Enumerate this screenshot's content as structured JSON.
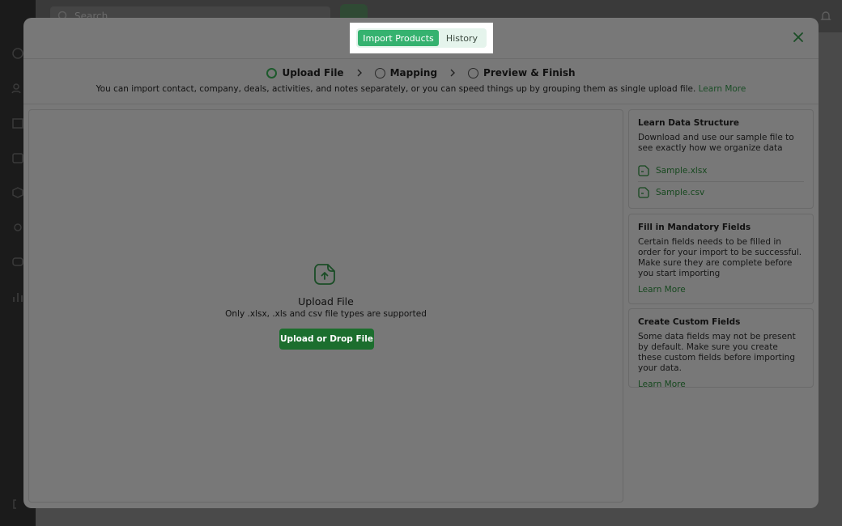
{
  "background": {
    "search_placeholder": "Search"
  },
  "modal": {
    "tabs": [
      {
        "label": "Import Products",
        "active": true
      },
      {
        "label": "History",
        "active": false
      }
    ],
    "steps": [
      {
        "label": "Upload File",
        "current": true
      },
      {
        "label": "Mapping",
        "current": false
      },
      {
        "label": "Preview & Finish",
        "current": false
      }
    ],
    "subtitle": "You can import contact, company, deals, activities, and notes separately, or you can speed things up by grouping them as single upload file.",
    "subtitle_link": "Learn More",
    "upload": {
      "title": "Upload File",
      "note": "Only .xlsx, .xls and csv file types are supported",
      "button": "Upload or Drop File"
    },
    "cards": {
      "learn": {
        "title": "Learn Data Structure",
        "text": "Download and use our sample file to see exactly how we organize  data",
        "files": [
          "Sample.xlsx",
          "Sample.csv"
        ]
      },
      "mandatory": {
        "title": "Fill in Mandatory Fields",
        "text": "Certain fields needs to be filled in order for your import to be successful. Make sure they are complete before you start importing",
        "link": "Learn More"
      },
      "custom": {
        "title": "Create Custom Fields",
        "text": "Some data fields may not be present by default. Make sure you create these custom fields before importing your data.",
        "link": "Learn More"
      }
    }
  },
  "colors": {
    "accent": "#35b26f",
    "primary_button": "#1c6e2e",
    "link": "#17481f"
  }
}
